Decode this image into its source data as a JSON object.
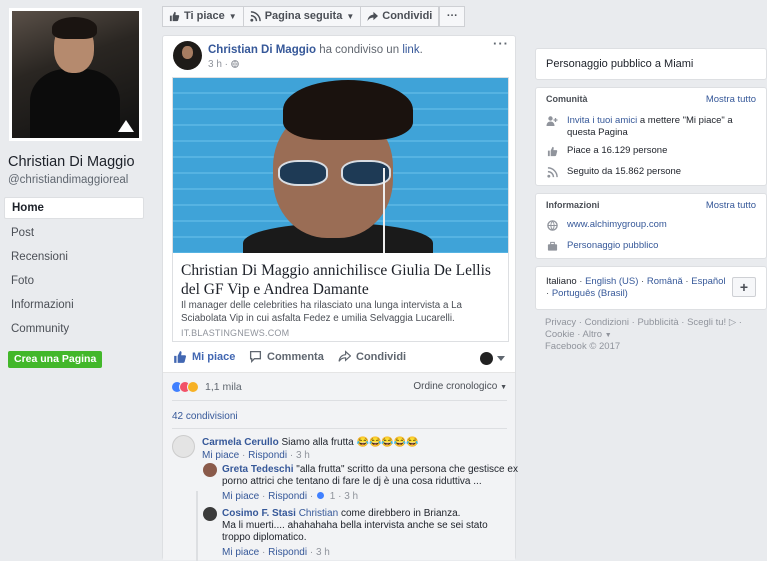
{
  "page": {
    "name": "Christian Di Maggio",
    "handle": "@christiandimaggioreal"
  },
  "left_nav": [
    {
      "label": "Home",
      "active": true
    },
    {
      "label": "Post"
    },
    {
      "label": "Recensioni"
    },
    {
      "label": "Foto"
    },
    {
      "label": "Informazioni"
    },
    {
      "label": "Community"
    }
  ],
  "create_page": "Crea una Pagina",
  "topbar": {
    "like": "Ti piace",
    "follow": "Pagina seguita",
    "share": "Condividi",
    "more": "···"
  },
  "post": {
    "author": "Christian Di Maggio",
    "action_text": "ha condiviso un",
    "action_link": "link",
    "time": "3 h ·",
    "menu": "···",
    "link": {
      "title": "Christian Di Maggio annichilisce Giulia De Lellis del GF Vip e Andrea Damante",
      "description": "Il manager delle celebrities ha rilasciato una lunga intervista a La Sciabolata Vip in cui asfalta Fedez e umilia Selvaggia Lucarelli.",
      "source": "IT.BLASTINGNEWS.COM"
    },
    "actions": {
      "like": "Mi piace",
      "comment": "Commenta",
      "share": "Condividi"
    },
    "reactions_count": "1,1 mila",
    "order": "Ordine cronologico",
    "shares": "42 condivisioni",
    "comments": [
      {
        "author": "Carmela Cerullo",
        "text": "Siamo alla frutta 😂😂😂😂😂",
        "like": "Mi piace",
        "reply": "Rispondi",
        "time": "3 h"
      },
      {
        "author": "Greta Tedeschi",
        "line1": "\"alla frutta\" scritto da una persona che gestisce ex",
        "line2": "porno attrici che tentano di fare le dj è una cosa riduttiva ...",
        "like": "Mi piace",
        "reply": "Rispondi",
        "likes": "1",
        "time": "3 h"
      },
      {
        "author": "Cosimo F. Stasi",
        "mention": "Christian",
        "line1": "come direbbero in Brianza.",
        "line2": "Ma li muerti.... ahahahaha bella intervista anche se sei stato",
        "line3": "troppo diplomatico.",
        "like": "Mi piace",
        "reply": "Rispondi",
        "time": "3 h"
      }
    ]
  },
  "right": {
    "public_figure": "Personaggio pubblico a Miami",
    "community": {
      "heading": "Comunità",
      "more": "Mostra tutto",
      "invite_link": "Invita i tuoi amici",
      "invite_text": "a mettere \"Mi piace\" a",
      "invite_text2": "questa Pagina",
      "likes": "Piace a 16.129 persone",
      "followers": "Seguito da 15.862 persone"
    },
    "info": {
      "heading": "Informazioni",
      "more": "Mostra tutto",
      "website": "www.alchimygroup.com",
      "category": "Personaggio pubblico"
    },
    "languages": {
      "current": "Italiano",
      "others": [
        "English (US)",
        "Română",
        "Español",
        "Português (Brasil)"
      ],
      "add": "+"
    },
    "footer": {
      "links": [
        "Privacy",
        "Condizioni",
        "Pubblicità",
        "Scegli tu!",
        "Cookie",
        "Altro"
      ],
      "copyright": "Facebook © 2017"
    }
  },
  "colors": {
    "link": "#365899",
    "like_blue": "#4267b2",
    "create_green": "#42b72a",
    "background": "#e9ebee"
  }
}
